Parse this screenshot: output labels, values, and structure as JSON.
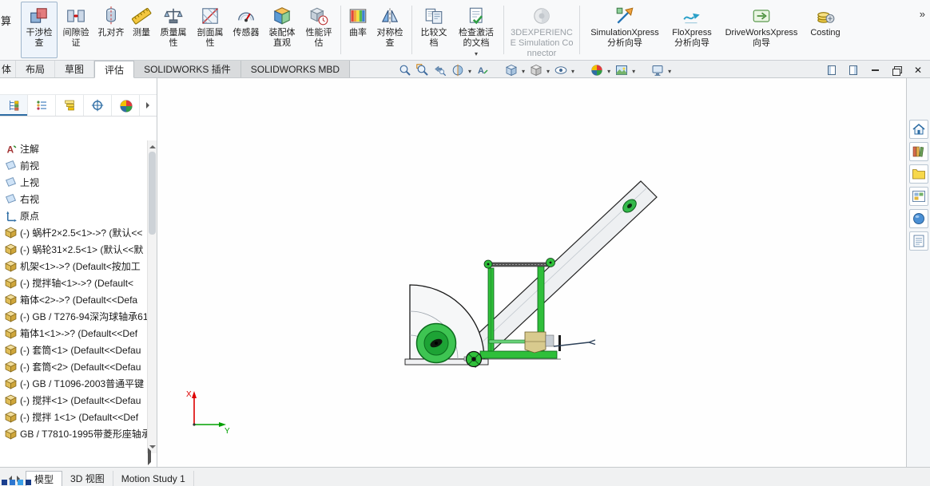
{
  "window": {
    "clipped_ribbon_text": "算",
    "clipped_tab_text": "体",
    "overflow_chevron": "»"
  },
  "colors": {
    "frame_green": "#2fbf3a",
    "disc_green": "#3ec452",
    "accent_blue": "#2e6da4",
    "ribbon_bg": "#f8f9fa",
    "viewport_bg": "#fefefe"
  },
  "ribbon": {
    "buttons": [
      {
        "label": "干涉检查",
        "icon": "interference-check-icon",
        "selected": true
      },
      {
        "label": "间隙验证",
        "icon": "clearance-verification-icon"
      },
      {
        "label": "孔对齐",
        "icon": "hole-alignment-icon"
      },
      {
        "label": "测量",
        "icon": "measure-icon"
      },
      {
        "label": "质量属性",
        "icon": "mass-properties-icon"
      },
      {
        "label": "剖面属性",
        "icon": "section-properties-icon"
      },
      {
        "label": "传感器",
        "icon": "sensor-icon"
      },
      {
        "label": "装配体直观",
        "icon": "assembly-visualization-icon"
      },
      {
        "label": "性能评估",
        "icon": "performance-evaluation-icon"
      },
      {
        "label": "曲率",
        "icon": "curvature-icon"
      },
      {
        "label": "对称检查",
        "icon": "symmetry-check-icon"
      },
      {
        "label": "比较文档",
        "icon": "compare-documents-icon"
      },
      {
        "label": "检查激活的文档",
        "icon": "check-active-document-icon",
        "dropdown": true
      },
      {
        "label": "3DEXPERIENCE Simulation Connector",
        "icon": "3dexperience-connector-icon",
        "disabled": true
      },
      {
        "label": "SimulationXpress 分析向导",
        "icon": "simulationxpress-icon"
      },
      {
        "label": "FloXpress 分析向导",
        "icon": "floxpress-icon"
      },
      {
        "label": "DriveWorksXpress 向导",
        "icon": "driveworksxpress-icon"
      },
      {
        "label": "Costing",
        "icon": "costing-icon"
      }
    ]
  },
  "command_tabs": {
    "items": [
      {
        "label": "布局"
      },
      {
        "label": "草图"
      },
      {
        "label": "评估",
        "active": true
      },
      {
        "label": "SOLIDWORKS 插件",
        "addin": true
      },
      {
        "label": "SOLIDWORKS MBD",
        "addin": true
      }
    ]
  },
  "headsup": {
    "icons": [
      {
        "name": "zoom-to-fit-icon",
        "dropdown": false
      },
      {
        "name": "zoom-to-area-icon",
        "dropdown": false
      },
      {
        "name": "previous-view-icon",
        "dropdown": false
      },
      {
        "name": "section-view-icon",
        "dropdown": true
      },
      {
        "name": "annotation-views-icon",
        "dropdown": false
      },
      {
        "name": "view-orientation-icon",
        "dropdown": true
      },
      {
        "name": "display-style-icon",
        "dropdown": true
      },
      {
        "name": "hide-show-items-icon",
        "dropdown": true
      },
      {
        "name": "edit-appearance-icon",
        "dropdown": true
      },
      {
        "name": "apply-scene-icon",
        "dropdown": true
      },
      {
        "name": "view-settings-icon",
        "dropdown": true
      }
    ]
  },
  "feature_manager": {
    "tabs": [
      "featuremanager-tree-icon",
      "propertymanager-icon",
      "configurationmanager-icon",
      "dimxpertmanager-icon",
      "displaymanager-icon"
    ],
    "items": [
      {
        "icon": "annotations-icon",
        "label": "注解"
      },
      {
        "icon": "plane-icon",
        "label": "前视"
      },
      {
        "icon": "plane-icon",
        "label": "上视"
      },
      {
        "icon": "plane-icon",
        "label": "右视"
      },
      {
        "icon": "origin-icon",
        "label": "原点"
      },
      {
        "icon": "part-icon",
        "label": "(-) 蜗杆2×2.5<1>->? (默认<<"
      },
      {
        "icon": "part-icon",
        "label": "(-) 蜗轮31×2.5<1> (默认<<默"
      },
      {
        "icon": "part-icon",
        "label": "机架<1>->? (Default<按加工"
      },
      {
        "icon": "part-icon",
        "label": "(-) 搅拌轴<1>->? (Default<"
      },
      {
        "icon": "part-icon",
        "label": "箱体<2>->? (Default<<Defa"
      },
      {
        "icon": "part-icon",
        "label": "(-) GB / T276-94深沟球轴承61"
      },
      {
        "icon": "part-icon",
        "label": "箱体1<1>->? (Default<<Def"
      },
      {
        "icon": "part-icon",
        "label": "(-) 套筒<1> (Default<<Defau"
      },
      {
        "icon": "part-icon",
        "label": "(-) 套筒<2> (Default<<Defau"
      },
      {
        "icon": "part-icon",
        "label": "(-) GB / T1096-2003普通平键"
      },
      {
        "icon": "part-icon",
        "label": "(-) 搅拌<1> (Default<<Defau"
      },
      {
        "icon": "part-icon",
        "label": "(-) 搅拌 1<1> (Default<<Def"
      },
      {
        "icon": "part-icon",
        "label": "GB / T7810-1995带菱形座轴承"
      }
    ]
  },
  "task_pane": {
    "icons": [
      "home-icon",
      "design-library-icon",
      "file-explorer-icon",
      "view-palette-icon",
      "appearances-scenes-icon",
      "custom-properties-icon"
    ]
  },
  "viewport": {
    "triad": {
      "x_label": "X",
      "y_label": "Y"
    }
  },
  "bottom_bar": {
    "tabs": [
      {
        "label": "模型",
        "active": true
      },
      {
        "label": "3D 视图"
      },
      {
        "label": "Motion Study 1"
      }
    ]
  }
}
